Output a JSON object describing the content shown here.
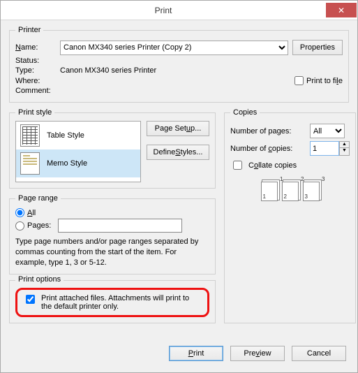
{
  "title": "Print",
  "close_glyph": "✕",
  "printer": {
    "legend": "Printer",
    "name_label": "Name:",
    "name_value": "Canon MX340 series Printer (Copy 2)",
    "properties_btn": "Properties",
    "status_label": "Status:",
    "status_value": "",
    "type_label": "Type:",
    "type_value": "Canon MX340 series Printer",
    "where_label": "Where:",
    "where_value": "",
    "comment_label": "Comment:",
    "comment_value": "",
    "print_to_file_label": "Print to file",
    "print_to_file_checked": false
  },
  "print_style": {
    "legend": "Print style",
    "items": [
      {
        "label": "Table Style",
        "selected": false,
        "icon": "table"
      },
      {
        "label": "Memo Style",
        "selected": true,
        "icon": "memo"
      }
    ],
    "page_setup_btn": "Page Setup...",
    "define_styles_btn": "Define Styles..."
  },
  "copies": {
    "legend": "Copies",
    "pages_label": "Number of pages:",
    "pages_value": "All",
    "copies_label": "Number of copies:",
    "copies_value": "1",
    "collate_label": "Collate copies",
    "collate_checked": false
  },
  "page_range": {
    "legend": "Page range",
    "all_label": "All",
    "pages_label": "Pages:",
    "pages_value": "",
    "selected": "all",
    "hint": "Type page numbers and/or page ranges separated by commas counting from the start of the item.  For example, type 1, 3 or 5-12."
  },
  "print_options": {
    "legend": "Print options",
    "attach_label": "Print attached files.  Attachments will print to the default printer only.",
    "attach_checked": true
  },
  "footer": {
    "print": "Print",
    "preview": "Preview",
    "cancel": "Cancel"
  }
}
